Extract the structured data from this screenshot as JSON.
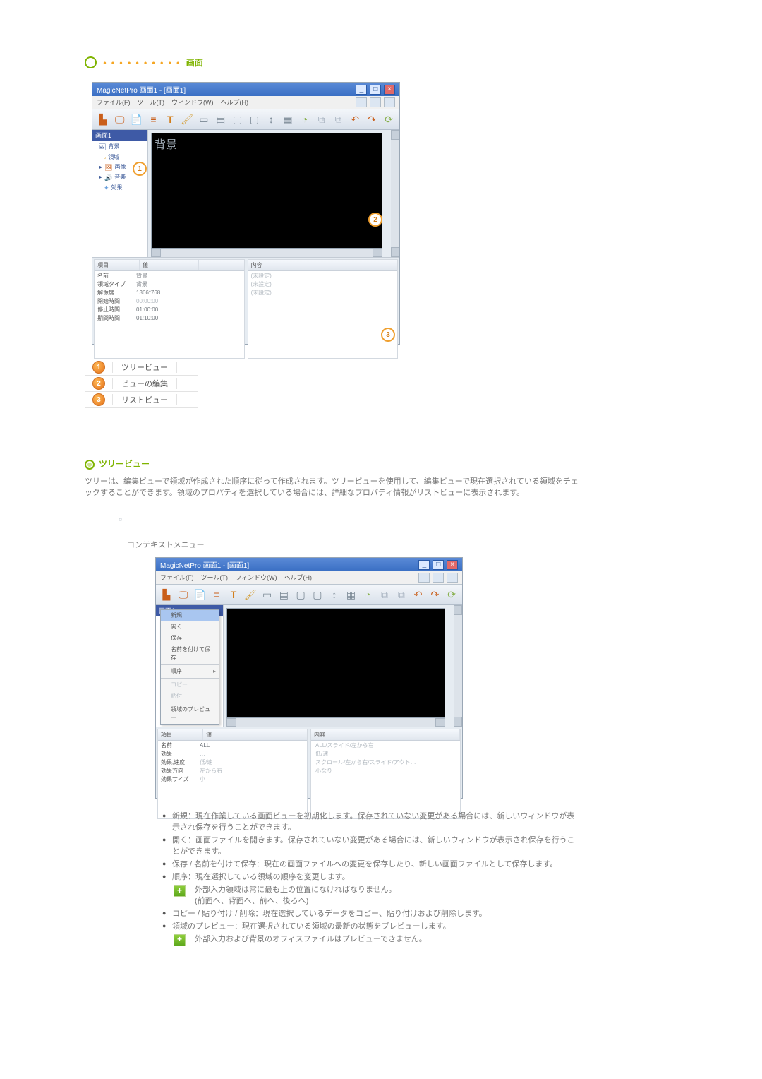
{
  "section_title": "画面",
  "window1": {
    "title": "MagicNetPro 画面1 - [画面1]",
    "menu": {
      "file": "ファイル(F)",
      "tool": "ツール(T)",
      "window": "ウィンドウ(W)",
      "help": "ヘルプ(H)"
    },
    "tree_header": "画面1",
    "tree_items": [
      "背景",
      "領域",
      "画像",
      "音楽",
      "効果"
    ],
    "canvas_label": "背景",
    "lv_left_headers": [
      "項目",
      "値"
    ],
    "lv_left_rows": [
      [
        "名前",
        "背景"
      ],
      [
        "領域タイプ",
        "背景"
      ],
      [
        "解像度",
        "1366*768"
      ],
      [
        "開始時間",
        "00:00:00"
      ],
      [
        "停止時間",
        "01:00:00"
      ],
      [
        "期間時間",
        "01:10:00"
      ]
    ],
    "lv_right_header": "内容",
    "lv_right_rows": [
      "(未設定)",
      "(未設定)",
      "(未設定)"
    ]
  },
  "legend": {
    "i1": "ツリービュー",
    "i2": "ビューの編集",
    "i3": "リストビュー"
  },
  "subheading": "ツリービュー",
  "paragraph": "ツリーは、編集ビューで領域が作成された順序に従って作成されます。ツリービューを使用して、編集ビューで現在選択されている領域をチェックすることができます。領域のプロパティを選択している場合には、詳細なプロパティ情報がリストビューに表示されます。",
  "context_title": "コンテキストメニュー",
  "context_menu": {
    "items": [
      "新規",
      "開く",
      "保存",
      "名前を付けて保存"
    ],
    "order": "順序",
    "disabled": [
      "コピー",
      "貼付"
    ],
    "preview": "領域のプレビュー"
  },
  "window2": {
    "lv_left_rows": [
      [
        "名前",
        "ALL"
      ],
      [
        "効果",
        "…"
      ],
      [
        "効果,速度",
        "低/速"
      ],
      [
        "効果方向",
        "左から右"
      ],
      [
        "効果サイズ",
        "小"
      ]
    ],
    "lv_right_rows": [
      "ALL/スライド/左から右",
      "低/速",
      "スクロール/左から右/スライド/アウト…",
      "小なり"
    ]
  },
  "bullets": {
    "b1": "新規：現在作業している画面ビューを初期化します。保存されていない変更がある場合には、新しいウィンドウが表示され保存を行うことができます。",
    "b2": "開く：画面ファイルを開きます。保存されていない変更がある場合には、新しいウィンドウが表示され保存を行うことができます。",
    "b3": "保存 / 名前を付けて保存：現在の画面ファイルへの変更を保存したり、新しい画面ファイルとして保存します。",
    "b4": "順序：現在選択している領域の順序を変更します。",
    "b4_note_line1": "外部入力領域は常に最も上の位置になければなりません。",
    "b4_note_line2": "(前面へ、背面へ、前へ、後ろへ)",
    "b5": "コピー / 貼り付け / 削除：現在選択しているデータをコピー、貼り付けおよび削除します。",
    "b6": "領域のプレビュー：現在選択されている領域の最新の状態をプレビューします。",
    "b6_note": "外部入力および背景のオフィスファイルはプレビューできません。"
  }
}
